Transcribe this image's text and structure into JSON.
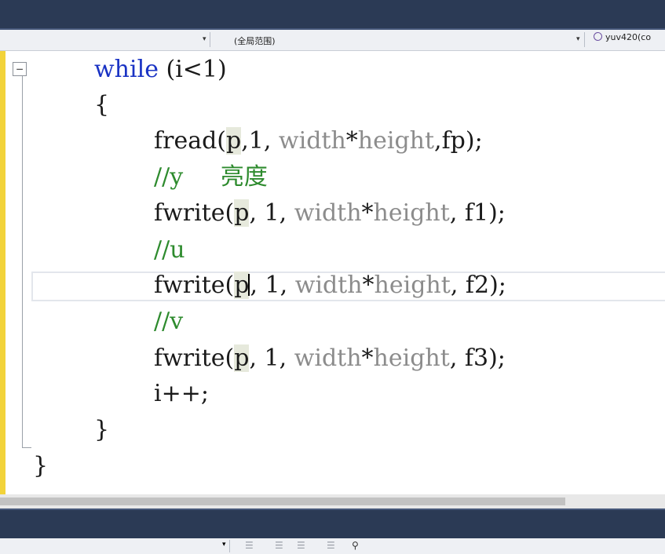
{
  "navigation": {
    "left_dropdown": "",
    "scope_dropdown": "(全局范围)",
    "member_dropdown": "yuv420(co"
  },
  "code_lines": [
    {
      "segments": [
        {
          "text": "while",
          "cls": "kw"
        },
        {
          "text": " (i<1)",
          "cls": ""
        }
      ]
    },
    {
      "segments": [
        {
          "text": "{",
          "cls": ""
        }
      ]
    },
    {
      "segments": [
        {
          "text": "fread(",
          "cls": ""
        },
        {
          "text": "p",
          "cls": "hl"
        },
        {
          "text": ",1, ",
          "cls": ""
        },
        {
          "text": "width",
          "cls": "ps"
        },
        {
          "text": "*",
          "cls": ""
        },
        {
          "text": "height",
          "cls": "ps"
        },
        {
          "text": ",fp);",
          "cls": ""
        }
      ]
    },
    {
      "segments": [
        {
          "text": "//y     亮度",
          "cls": "cm"
        }
      ]
    },
    {
      "segments": [
        {
          "text": "fwrite(",
          "cls": ""
        },
        {
          "text": "p",
          "cls": "hl"
        },
        {
          "text": ", 1, ",
          "cls": ""
        },
        {
          "text": "width",
          "cls": "ps"
        },
        {
          "text": "*",
          "cls": ""
        },
        {
          "text": "height",
          "cls": "ps"
        },
        {
          "text": ", f1);",
          "cls": ""
        }
      ]
    },
    {
      "segments": [
        {
          "text": "//u",
          "cls": "cm"
        }
      ]
    },
    {
      "segments": [
        {
          "text": "fwrite(",
          "cls": ""
        },
        {
          "text": "p",
          "cls": "hl"
        },
        {
          "text": "|caret|",
          "cls": "caret"
        },
        {
          "text": ", 1, ",
          "cls": ""
        },
        {
          "text": "width",
          "cls": "ps"
        },
        {
          "text": "*",
          "cls": ""
        },
        {
          "text": "height",
          "cls": "ps"
        },
        {
          "text": ", f2);",
          "cls": ""
        }
      ]
    },
    {
      "segments": [
        {
          "text": "//v",
          "cls": "cm"
        }
      ]
    },
    {
      "segments": [
        {
          "text": "fwrite(",
          "cls": ""
        },
        {
          "text": "p",
          "cls": "hl"
        },
        {
          "text": ", 1, ",
          "cls": ""
        },
        {
          "text": "width",
          "cls": "ps"
        },
        {
          "text": "*",
          "cls": ""
        },
        {
          "text": "height",
          "cls": "ps"
        },
        {
          "text": ", f3);",
          "cls": ""
        }
      ]
    },
    {
      "segments": [
        {
          "text": "i++;",
          "cls": ""
        }
      ]
    },
    {
      "segments": [
        {
          "text": "}",
          "cls": ""
        }
      ]
    },
    {
      "segments": [
        {
          "text": "}",
          "cls": ""
        }
      ]
    }
  ],
  "colors": {
    "keyword": "#1a33c4",
    "comment": "#2e8b2e",
    "parameter": "#8c8c8c",
    "change_bar": "#f2d33a",
    "title_bar": "#2b3a55"
  },
  "icons": {
    "fold": "collapse-minus-icon",
    "member": "method-circle-icon",
    "dropdown": "dropdown-arrow-icon"
  }
}
